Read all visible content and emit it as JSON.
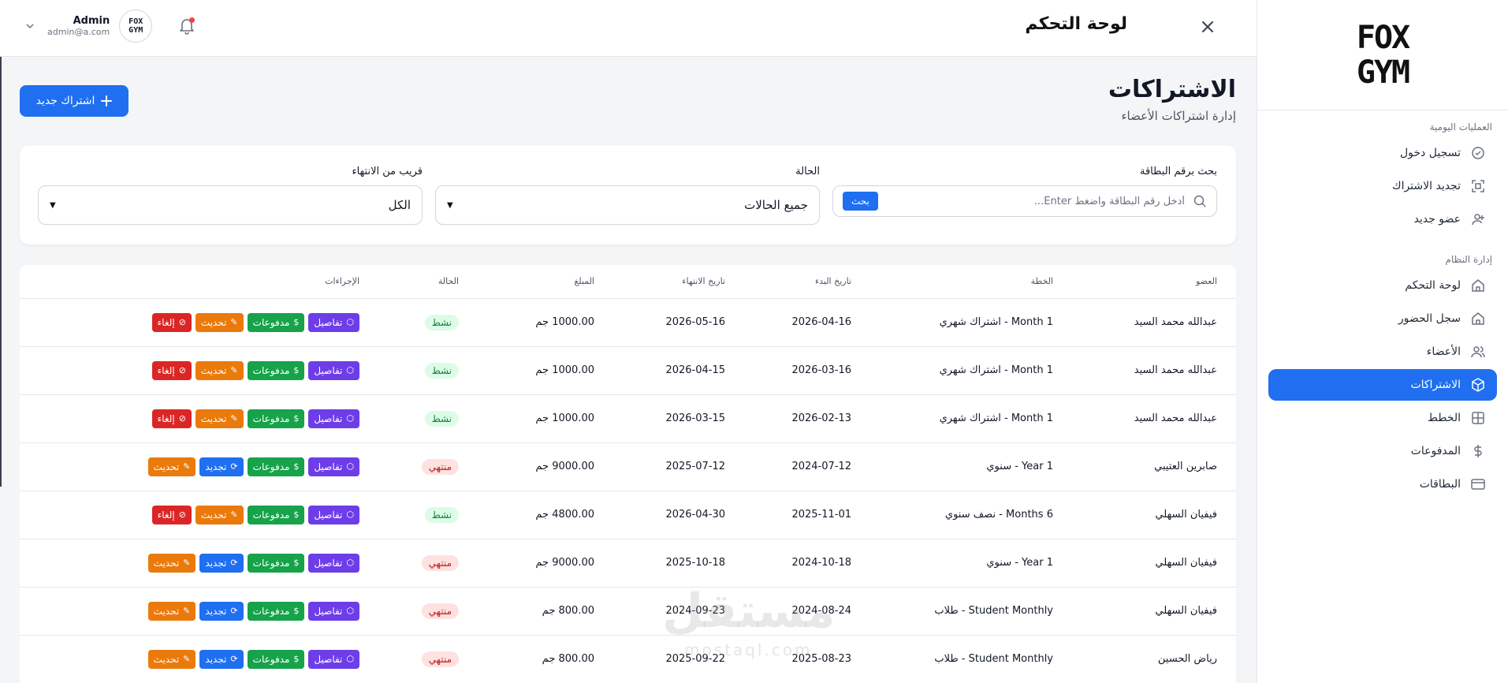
{
  "sidebar": {
    "logo": {
      "line1": "FOX",
      "line2": "GYM"
    },
    "sections": [
      {
        "title": "العمليات اليومية",
        "items": [
          {
            "label": "تسجيل دخول",
            "icon": "check-circle-icon",
            "active": false
          },
          {
            "label": "تجديد الاشتراك",
            "icon": "scan-icon",
            "active": false
          },
          {
            "label": "عضو جديد",
            "icon": "user-plus-icon",
            "active": false
          }
        ]
      },
      {
        "title": "إدارة النظام",
        "items": [
          {
            "label": "لوحة التحكم",
            "icon": "home-icon",
            "active": false
          },
          {
            "label": "سجل الحضور",
            "icon": "home-icon",
            "active": false
          },
          {
            "label": "الأعضاء",
            "icon": "users-icon",
            "active": false
          },
          {
            "label": "الاشتراكات",
            "icon": "box-icon",
            "active": true
          },
          {
            "label": "الخطط",
            "icon": "grid-icon",
            "active": false
          },
          {
            "label": "المدفوعات",
            "icon": "dollar-icon",
            "active": false
          },
          {
            "label": "البطاقات",
            "icon": "card-icon",
            "active": false
          }
        ]
      }
    ]
  },
  "header": {
    "title": "لوحة التحكم",
    "user": {
      "name": "Admin",
      "email": "admin@a.com",
      "avatar_text": "FOX GYM"
    }
  },
  "page": {
    "title": "الاشتراكات",
    "subtitle": "إدارة اشتراكات الأعضاء",
    "new_button": "اشتراك جديد"
  },
  "filters": {
    "search_label": "بحث برقم البطاقة",
    "search_placeholder": "أدخل رقم البطاقة واضغط Enter...",
    "search_button": "بحث",
    "status_label": "الحالة",
    "status_value": "جميع الحالات",
    "expiry_label": "قريب من الانتهاء",
    "expiry_value": "الكل"
  },
  "table": {
    "headers": [
      "العضو",
      "الخطة",
      "تاريخ البدء",
      "تاريخ الانتهاء",
      "المبلغ",
      "الحالة",
      "الإجراءات"
    ],
    "action_labels": {
      "details": "تفاصيل",
      "payments": "مدفوعات",
      "update": "تحديث",
      "renew": "تجديد",
      "cancel": "إلغاء"
    },
    "rows": [
      {
        "member": "عبدالله محمد السيد",
        "plan": "1 Month - اشتراك شهري",
        "start": "2026-04-16",
        "end": "2026-05-16",
        "amount": "1000.00 جم",
        "status": "نشط",
        "status_type": "active"
      },
      {
        "member": "عبدالله محمد السيد",
        "plan": "1 Month - اشتراك شهري",
        "start": "2026-03-16",
        "end": "2026-04-15",
        "amount": "1000.00 جم",
        "status": "نشط",
        "status_type": "active"
      },
      {
        "member": "عبدالله محمد السيد",
        "plan": "1 Month - اشتراك شهري",
        "start": "2026-02-13",
        "end": "2026-03-15",
        "amount": "1000.00 جم",
        "status": "نشط",
        "status_type": "active"
      },
      {
        "member": "صابرين العتيبي",
        "plan": "1 Year - سنوي",
        "start": "2024-07-12",
        "end": "2025-07-12",
        "amount": "9000.00 جم",
        "status": "منتهي",
        "status_type": "ended"
      },
      {
        "member": "فيفيان السهلي",
        "plan": "6 Months - نصف سنوي",
        "start": "2025-11-01",
        "end": "2026-04-30",
        "amount": "4800.00 جم",
        "status": "نشط",
        "status_type": "active"
      },
      {
        "member": "فيفيان السهلي",
        "plan": "1 Year - سنوي",
        "start": "2024-10-18",
        "end": "2025-10-18",
        "amount": "9000.00 جم",
        "status": "منتهي",
        "status_type": "ended"
      },
      {
        "member": "فيفيان السهلي",
        "plan": "Student Monthly - طلاب",
        "start": "2024-08-24",
        "end": "2024-09-23",
        "amount": "800.00 جم",
        "status": "منتهي",
        "status_type": "ended"
      },
      {
        "member": "رياض الحسين",
        "plan": "Student Monthly - طلاب",
        "start": "2025-08-23",
        "end": "2025-09-22",
        "amount": "800.00 جم",
        "status": "منتهي",
        "status_type": "ended"
      }
    ]
  },
  "watermark": {
    "text": "مستقل",
    "sub": "mostaql.com"
  },
  "colors": {
    "primary": "#1f6ff0",
    "details": "#6d3de8",
    "payments": "#16a34a",
    "update": "#ea7a0c",
    "cancel": "#dc2626"
  }
}
